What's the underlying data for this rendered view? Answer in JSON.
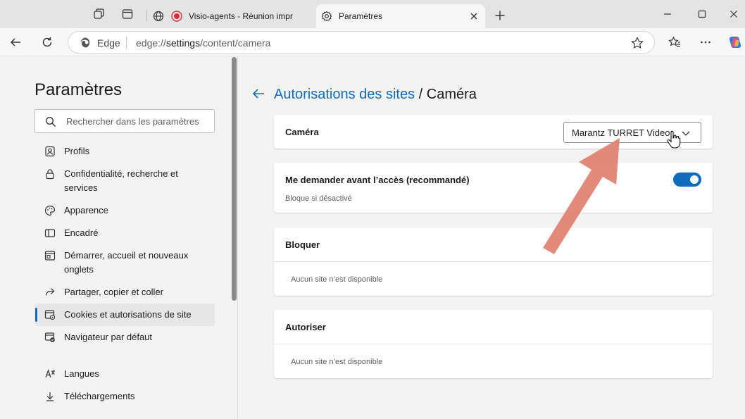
{
  "browser": {
    "tabs": [
      {
        "title": "Visio-agents - Réunion impr",
        "active": false
      },
      {
        "title": "Paramètres",
        "active": true
      }
    ],
    "address": {
      "site_label": "Edge",
      "url_prefix": "edge://",
      "url_bold": "settings",
      "url_rest": "/content/camera"
    }
  },
  "sidebar": {
    "title": "Paramètres",
    "search_placeholder": "Rechercher dans les paramètres",
    "items": [
      {
        "label": "Profils",
        "icon": "profile-icon"
      },
      {
        "label": "Confidentialité, recherche et services",
        "icon": "lock-icon"
      },
      {
        "label": "Apparence",
        "icon": "palette-icon"
      },
      {
        "label": "Encadré",
        "icon": "sidebar-panel-icon"
      },
      {
        "label": "Démarrer, accueil et nouveaux onglets",
        "icon": "home-tabs-icon"
      },
      {
        "label": "Partager, copier et coller",
        "icon": "share-icon"
      },
      {
        "label": "Cookies et autorisations de site",
        "icon": "cookie-permissions-icon",
        "selected": true
      },
      {
        "label": "Navigateur par défaut",
        "icon": "default-browser-icon"
      },
      {
        "label": "Langues",
        "icon": "language-icon"
      },
      {
        "label": "Téléchargements",
        "icon": "download-icon"
      }
    ]
  },
  "main": {
    "breadcrumb": {
      "parent": "Autorisations des sites",
      "separator": "/",
      "current": "Caméra"
    },
    "camera": {
      "label": "Caméra",
      "selected_device": "Marantz TURRET Video"
    },
    "ask": {
      "label": "Me demander avant l’accès (recommandé)",
      "subtext": "Bloque si désactivé",
      "enabled": true
    },
    "block": {
      "title": "Bloquer",
      "empty": "Aucun site n’est disponible"
    },
    "allow": {
      "title": "Autoriser",
      "empty": "Aucun site n’est disponible"
    }
  },
  "colors": {
    "accent": "#0f6cbd",
    "annotation_arrow": "#e0806e"
  }
}
